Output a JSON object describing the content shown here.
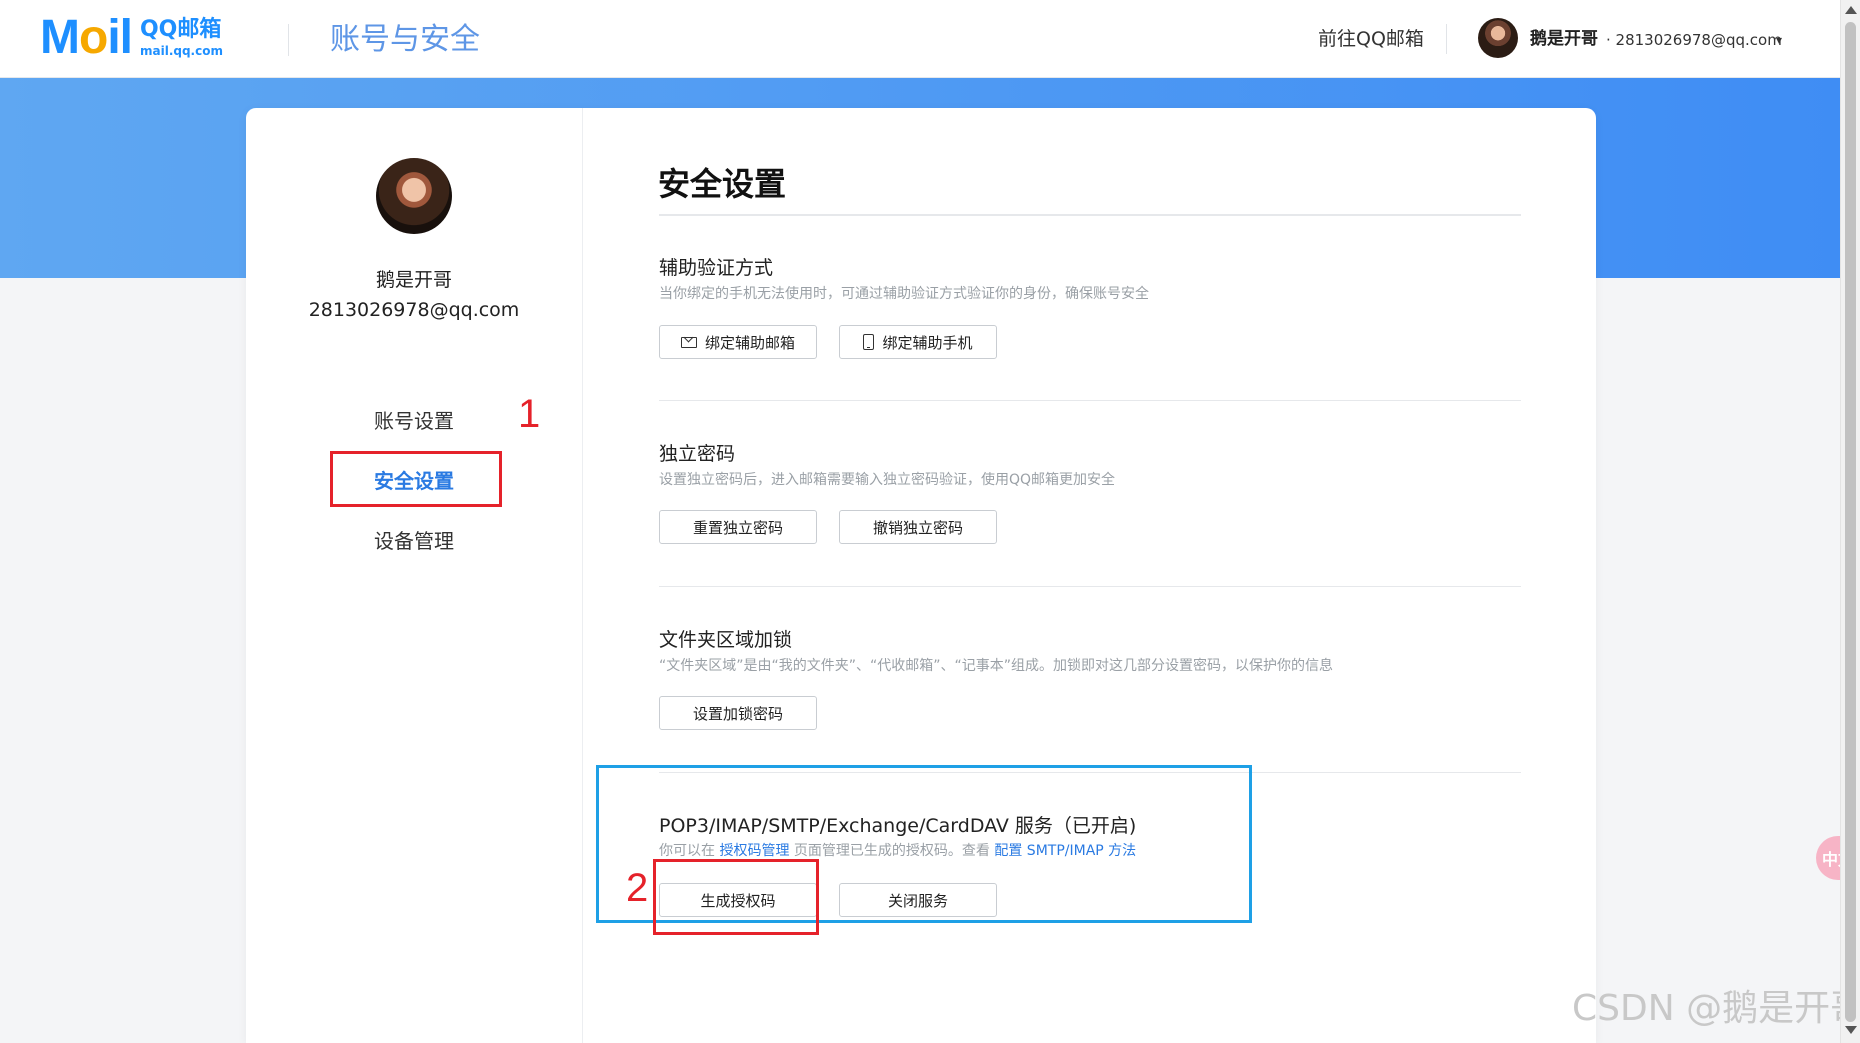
{
  "header": {
    "logo_mark_a": "M",
    "logo_mark_o": "o",
    "logo_mark_b": "il",
    "logo_cn": "QQ邮箱",
    "logo_en": "mail.qq.com",
    "page_title": "账号与安全",
    "goto_mail": "前往QQ邮箱",
    "user_name": "鹅是开哥",
    "user_email": "· 2813026978@qq.com",
    "caret": "▾"
  },
  "sidebar": {
    "name": "鹅是开哥",
    "email": "2813026978@qq.com",
    "items": [
      {
        "label": "账号设置"
      },
      {
        "label": "安全设置"
      },
      {
        "label": "设备管理"
      }
    ],
    "annotation_1": "1"
  },
  "main": {
    "title": "安全设置",
    "blocks": [
      {
        "title": "辅助验证方式",
        "desc": "当你绑定的手机无法使用时，可通过辅助验证方式验证你的身份，确保账号安全",
        "buttons": [
          "绑定辅助邮箱",
          "绑定辅助手机"
        ]
      },
      {
        "title": "独立密码",
        "desc": "设置独立密码后，进入邮箱需要输入独立密码验证，使用QQ邮箱更加安全",
        "buttons": [
          "重置独立密码",
          "撤销独立密码"
        ]
      },
      {
        "title": "文件夹区域加锁",
        "desc": "“文件夹区域”是由“我的文件夹”、“代收邮箱”、“记事本”组成。加锁即对这几部分设置密码，以保护你的信息",
        "buttons": [
          "设置加锁密码"
        ]
      },
      {
        "title": "POP3/IMAP/SMTP/Exchange/CardDAV 服务（已开启)",
        "desc_pre": "你可以在",
        "desc_link1": "授权码管理",
        "desc_mid": "页面管理已生成的授权码。查看",
        "desc_link2": "配置 SMTP/IMAP 方法",
        "buttons": [
          "生成授权码",
          "关闭服务"
        ]
      }
    ],
    "annotation_2": "2"
  },
  "misc": {
    "watermark": "CSDN @鹅是开哥",
    "float_badge": "中文"
  },
  "colors": {
    "accent": "#2a7ae2",
    "band": "#3f8df4",
    "annot_red": "#e5222a",
    "annot_blue": "#1ea0e6"
  },
  "icons": [
    "mail-icon",
    "phone-icon",
    "caret-down-icon"
  ]
}
